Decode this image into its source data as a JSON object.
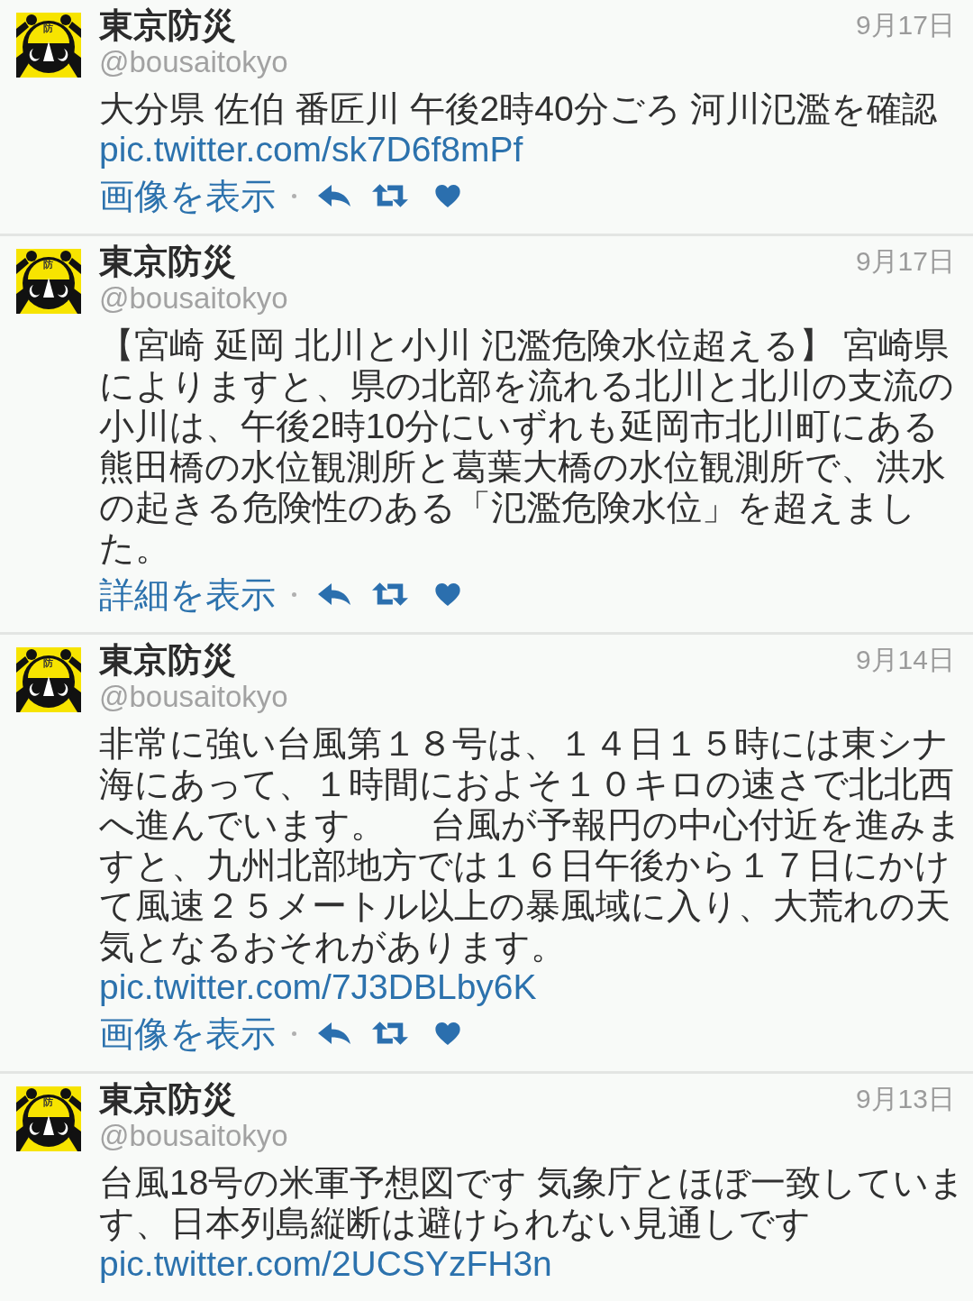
{
  "tweets": [
    {
      "author": "東京防災",
      "handle": "@bousaitokyo",
      "date": "9月17日",
      "avatar_mark": "防",
      "text": "大分県 佐伯 番匠川 午後2時40分ごろ 河川氾濫を確認",
      "link": "pic.twitter.com/sk7D6f8mPf",
      "action_label": "画像を表示"
    },
    {
      "author": "東京防災",
      "handle": "@bousaitokyo",
      "date": "9月17日",
      "avatar_mark": "防",
      "text": "【宮崎 延岡 北川と小川 氾濫危険水位超える】 宮崎県によりますと、県の北部を流れる北川と北川の支流の小川は、午後2時10分にいずれも延岡市北川町にある熊田橋の水位観測所と葛葉大橋の水位観測所で、洪水の起きる危険性のある「氾濫危険水位」を超えました。",
      "action_label": "詳細を表示"
    },
    {
      "author": "東京防災",
      "handle": "@bousaitokyo",
      "date": "9月14日",
      "avatar_mark": "防",
      "text": "非常に強い台風第１８号は、１４日１５時には東シナ海にあって、１時間におよそ１０キロの速さで北北西へ進んでいます。　 台風が予報円の中心付近を進みますと、九州北部地方では１６日午後から１７日にかけて風速２５メートル以上の暴風域に入り、大荒れの天気となるおそれがあります。",
      "link": "pic.twitter.com/7J3DBLby6K",
      "action_label": "画像を表示"
    },
    {
      "author": "東京防災",
      "handle": "@bousaitokyo",
      "date": "9月13日",
      "avatar_mark": "防",
      "text": "台風18号の米軍予想図です 気象庁とほぼ一致しています、日本列島縦断は避けられない見通しです",
      "link": "pic.twitter.com/2UCSYzFH3n"
    }
  ]
}
